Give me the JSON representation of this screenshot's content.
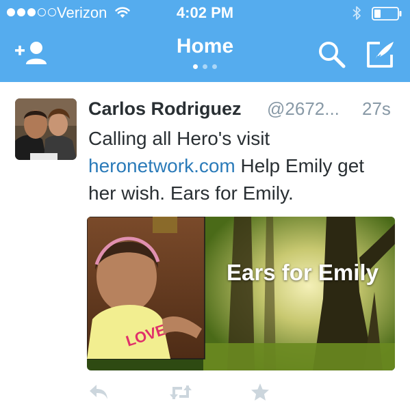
{
  "status_bar": {
    "carrier": "Verizon",
    "time": "4:02 PM",
    "signal_strength": 3,
    "signal_max": 5,
    "icons": [
      "wifi-icon",
      "bluetooth-icon",
      "battery-icon"
    ]
  },
  "nav": {
    "title": "Home",
    "page_count": 3,
    "active_page": 1,
    "icons": [
      "add-user-icon",
      "search-icon",
      "compose-icon"
    ]
  },
  "tweet": {
    "name": "Carlos Rodriguez",
    "handle": "@2672...",
    "time": "27s",
    "text_before": "Calling all Hero's visit ",
    "link": "heronetwork.com",
    "text_after": " Help Emily get her wish. Ears for Emily.",
    "media_caption": "Ears for Emily",
    "actions": [
      "reply-icon",
      "retweet-icon",
      "favorite-icon"
    ]
  },
  "colors": {
    "header_bg": "#55ACEE",
    "link": "#2b7bb9",
    "text": "#292f33",
    "muted": "#8899a6",
    "action_icon": "#ccd6dd"
  }
}
